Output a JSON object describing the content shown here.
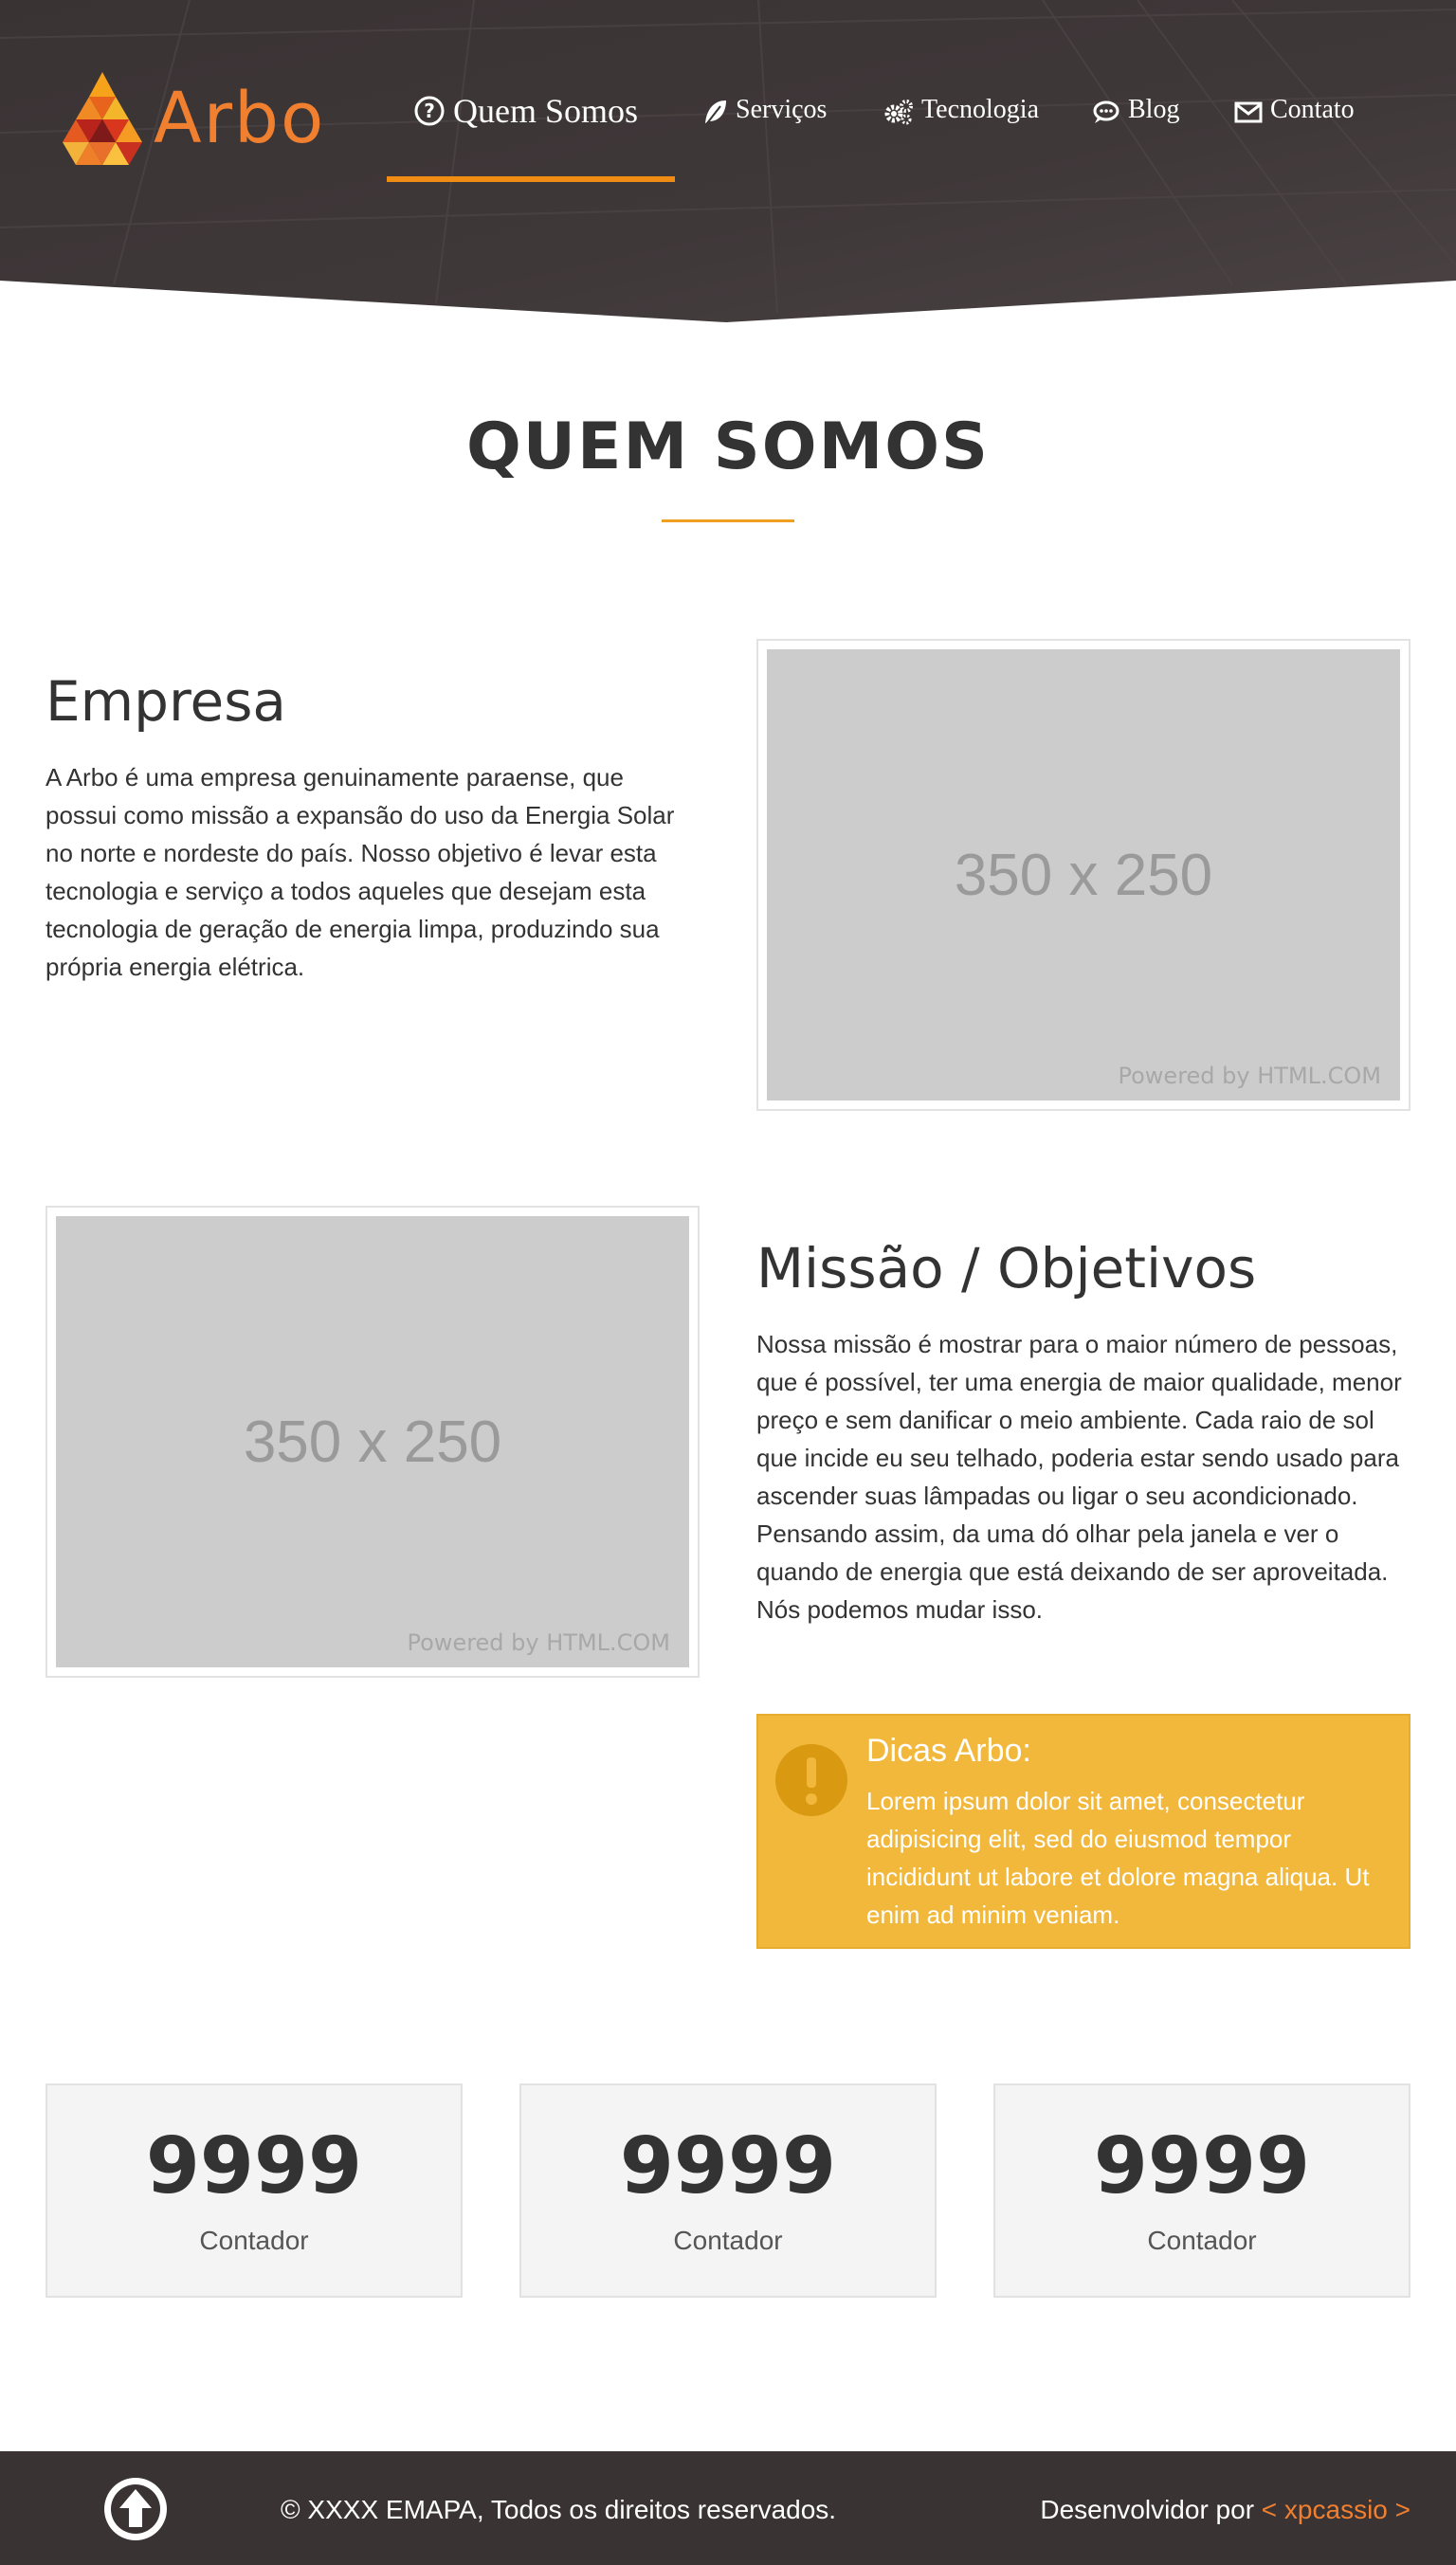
{
  "brand": {
    "name": "Arbo",
    "logo_icon": "triangle-mosaic-logo",
    "accent_color": "#f08030"
  },
  "nav": {
    "items": [
      {
        "label": "Quem Somos",
        "icon": "question-circle-icon",
        "active": true
      },
      {
        "label": "Serviços",
        "icon": "leaf-icon",
        "active": false
      },
      {
        "label": "Tecnologia",
        "icon": "gears-icon",
        "active": false
      },
      {
        "label": "Blog",
        "icon": "comment-dots-icon",
        "active": false
      },
      {
        "label": "Contato",
        "icon": "envelope-icon",
        "active": false
      }
    ],
    "active_color": "#f08b14"
  },
  "page": {
    "title": "QUEM SOMOS"
  },
  "empresa": {
    "heading": "Empresa",
    "text": "A Arbo é uma empresa genuinamente paraense, que possui como missão a expansão do uso da Energia Solar no norte e nordeste do país. Nosso objetivo é levar esta tecnologia e serviço a todos aqueles que desejam esta tecnologia de geração de energia limpa, produzindo sua própria energia elétrica.",
    "image_label": "350 x 250",
    "image_credit": "Powered by HTML.COM"
  },
  "missao": {
    "heading": "Missão / Objetivos",
    "text": "Nossa missão é mostrar para o maior número de pessoas, que é possível, ter uma energia de maior qualidade, menor preço e sem danificar o meio ambiente. Cada raio de sol que incide eu seu telhado, poderia estar sendo usado para ascender suas lâmpadas ou ligar o seu acondicionado. Pensando assim, da uma dó olhar pela janela e ver o quando de energia que está deixando de ser aproveitada. Nós podemos mudar isso.",
    "image_label": "350 x 250",
    "image_credit": "Powered by HTML.COM"
  },
  "tip": {
    "title": "Dicas Arbo:",
    "text": "Lorem ipsum dolor sit amet, consectetur adipisicing elit, sed do eiusmod tempor incididunt ut labore et dolore magna aliqua. Ut enim ad minim veniam.",
    "icon": "exclamation-circle-icon",
    "color": "#f1b83c"
  },
  "counters": [
    {
      "value": "9999",
      "label": "Contador"
    },
    {
      "value": "9999",
      "label": "Contador"
    },
    {
      "value": "9999",
      "label": "Contador"
    }
  ],
  "footer": {
    "copyright": "© XXXX EMAPA, Todos os direitos reservados.",
    "dev_prefix": "Desenvolvidor por",
    "dev_link": "< xpcassio >",
    "back_to_top_icon": "arrow-up-circle-icon"
  }
}
